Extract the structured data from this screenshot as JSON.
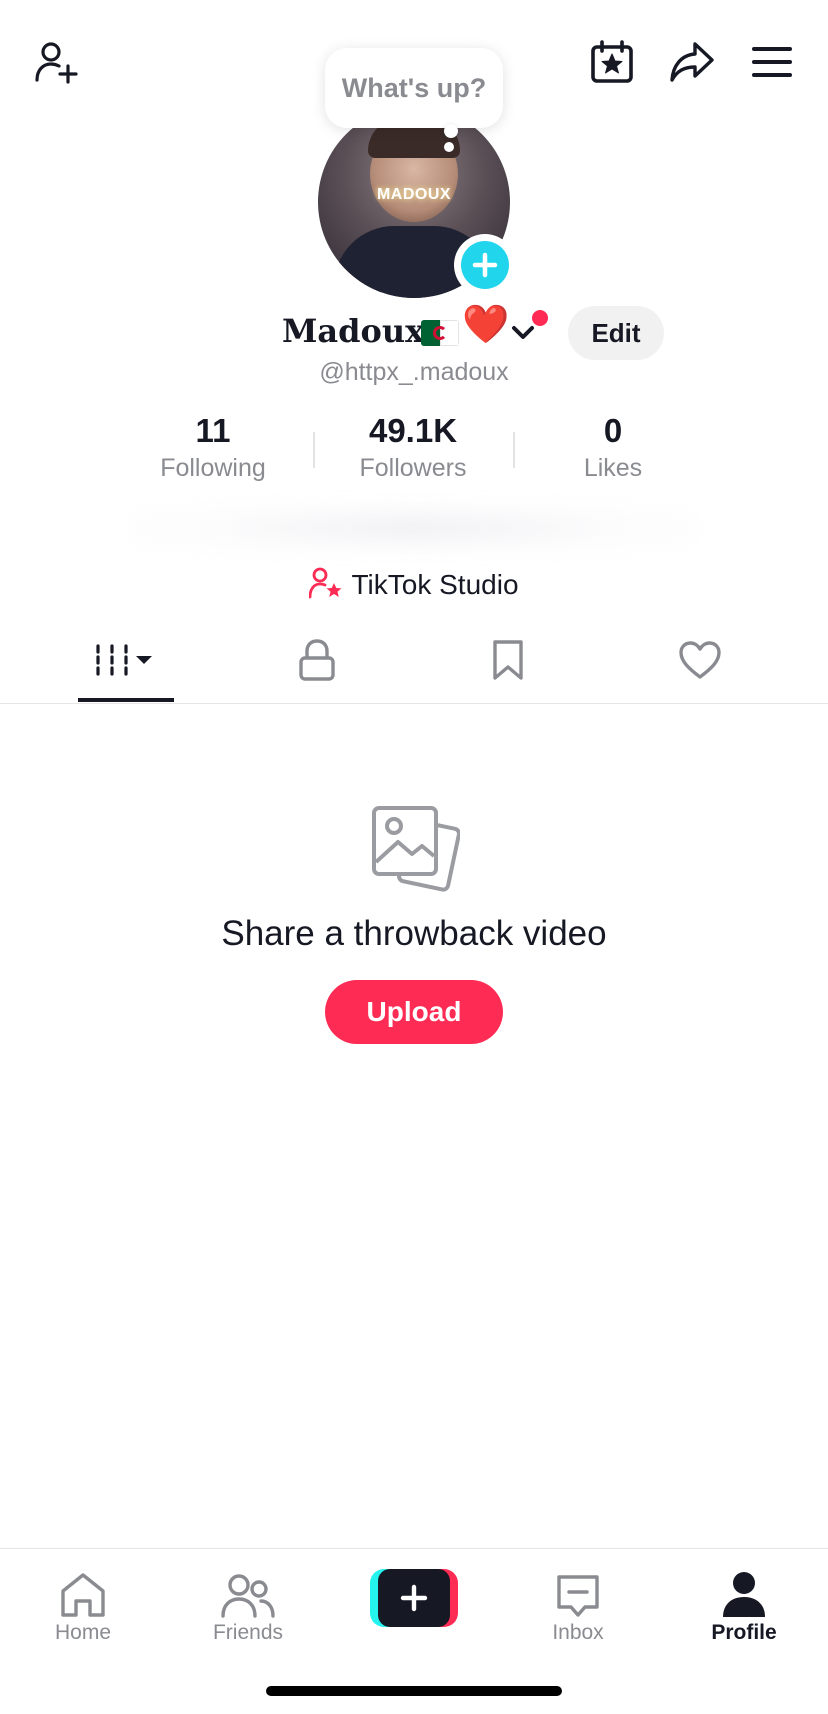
{
  "bubble": {
    "text": "What's up?"
  },
  "avatar": {
    "watermark": "MADOUX"
  },
  "profile": {
    "display_name": "Madoux",
    "emojis": "❤️",
    "handle": "@httpx_.madoux",
    "edit_label": "Edit"
  },
  "stats": [
    {
      "value": "11",
      "label": "Following"
    },
    {
      "value": "49.1K",
      "label": "Followers"
    },
    {
      "value": "0",
      "label": "Likes"
    }
  ],
  "studio": {
    "label": "TikTok Studio"
  },
  "tabs": [
    {
      "icon": "grid-icon",
      "active": true
    },
    {
      "icon": "lock-icon",
      "active": false
    },
    {
      "icon": "bookmark-icon",
      "active": false
    },
    {
      "icon": "heart-icon",
      "active": false
    }
  ],
  "empty_state": {
    "title": "Share a throwback video",
    "button": "Upload"
  },
  "bottom_nav": [
    {
      "label": "Home",
      "icon": "home-icon"
    },
    {
      "label": "Friends",
      "icon": "friends-icon"
    },
    {
      "label": "",
      "icon": "create-icon"
    },
    {
      "label": "Inbox",
      "icon": "inbox-icon"
    },
    {
      "label": "Profile",
      "icon": "profile-icon",
      "active": true
    }
  ],
  "colors": {
    "accent": "#fe2c55",
    "cyan": "#20d5ec",
    "text": "#161823",
    "muted": "#8a8b91"
  }
}
